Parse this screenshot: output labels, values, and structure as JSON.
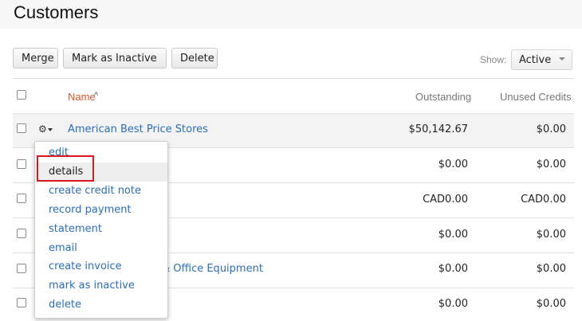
{
  "header": {
    "title": "Customers"
  },
  "toolbar": {
    "merge_label": "Merge",
    "inactive_label": "Mark as Inactive",
    "delete_label": "Delete",
    "show_label": "Show:",
    "show_value": "Active"
  },
  "table": {
    "columns": {
      "name": "Name",
      "outstanding": "Outstanding",
      "credits": "Unused Credits"
    },
    "rows": [
      {
        "name": "American Best Price Stores",
        "outstanding": "$50,142.67",
        "credits": "$0.00"
      },
      {
        "name": "",
        "outstanding": "$0.00",
        "credits": "$0.00"
      },
      {
        "name": "",
        "outstanding": "CAD0.00",
        "credits": "CAD0.00"
      },
      {
        "name": "",
        "outstanding": "$0.00",
        "credits": "$0.00"
      },
      {
        "name": "& Office Equipment",
        "outstanding": "$0.00",
        "credits": "$0.00"
      },
      {
        "name": "",
        "outstanding": "$0.00",
        "credits": "$0.00"
      }
    ]
  },
  "menu": {
    "items": [
      "edit",
      "details",
      "create credit note",
      "record payment",
      "statement",
      "email",
      "create invoice",
      "mark as inactive",
      "delete"
    ],
    "selected": "details"
  },
  "icons": {
    "row_menu": "gear-icon",
    "sort": "sort-ascending-icon"
  },
  "colors": {
    "accent": "#d8552b",
    "link": "#2a6ebb",
    "highlight": "#d9161e"
  }
}
